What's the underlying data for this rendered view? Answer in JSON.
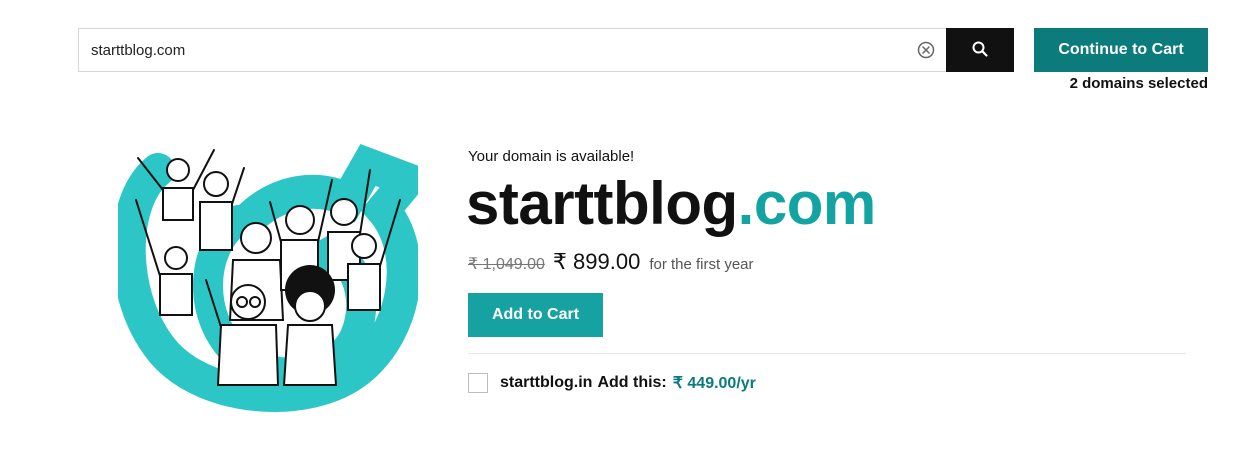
{
  "search": {
    "value": "starttblog.com",
    "clear_icon": "clear-circle-x-icon",
    "search_icon": "magnifier-icon"
  },
  "cart": {
    "continue_label": "Continue to Cart",
    "selected_text": "2 domains selected"
  },
  "result": {
    "availability": "Your domain is available!",
    "sld": "starttblog",
    "tld": ".com",
    "old_price": "₹ 1,049.00",
    "price": "₹ 899.00",
    "price_note": "for the first year",
    "add_to_cart_label": "Add to Cart"
  },
  "upsell": {
    "domain": "starttblog.in",
    "label": "Add this:",
    "price": "₹ 449.00/yr",
    "checked": false
  },
  "colors": {
    "accent_dark": "#0b7b7b",
    "accent": "#17a2a2",
    "tld": "#14a3a3",
    "search_button": "#111111"
  }
}
